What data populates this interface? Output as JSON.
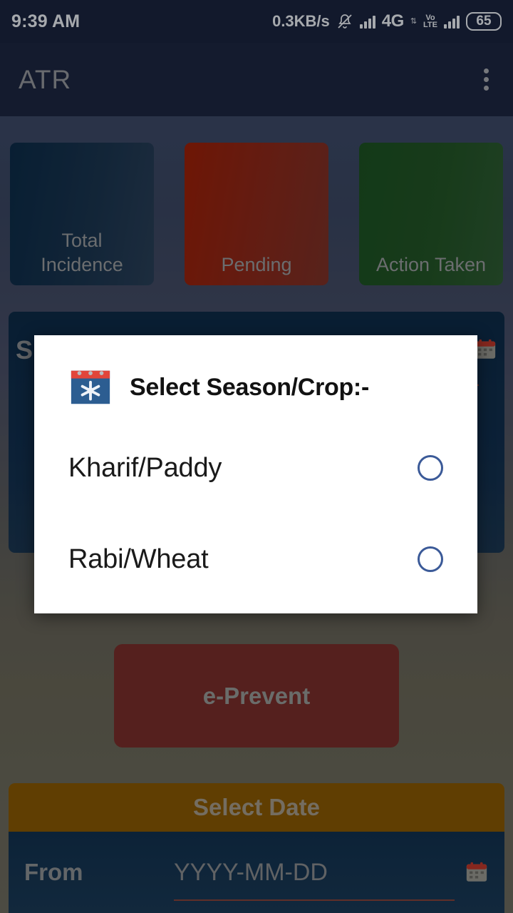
{
  "status_bar": {
    "time": "9:39 AM",
    "network_speed": "0.3KB/s",
    "mute_icon": "bell-muted-icon",
    "signal_icon_1": "signal-bars-icon",
    "network_type": "4G",
    "data_arrows": "⇅",
    "volte_top": "Vo",
    "volte_bottom": "LTE",
    "signal_icon_2": "signal-bars-icon",
    "battery_level": "65"
  },
  "app_bar": {
    "title": "ATR",
    "overflow_icon": "more-vertical-icon"
  },
  "stats": [
    {
      "label": "Total\nIncidence",
      "label_line1": "Total",
      "label_line2": "Incidence",
      "color": "#0c2c49",
      "name": "total-incidence"
    },
    {
      "label": "Pending",
      "label_line1": "Pending",
      "label_line2": "",
      "color": "#9e2008",
      "name": "pending"
    },
    {
      "label": "Action Taken",
      "label_line1": "Action Taken",
      "label_line2": "",
      "color": "#1c5223",
      "name": "action-taken"
    }
  ],
  "season_card": {
    "label": "S",
    "calendar_icon": "calendar-icon"
  },
  "eprevent": {
    "label": "e-Prevent",
    "color": "#7a2f2b"
  },
  "date_panel": {
    "header": "Select Date",
    "header_color": "#8a5a04",
    "from_label": "From",
    "from_placeholder": "YYYY-MM-DD",
    "calendar_icon": "calendar-icon"
  },
  "dialog": {
    "icon": "calendar-snowflake-icon",
    "title": "Select Season/Crop:-",
    "accent_color": "#3b5a98",
    "options": [
      {
        "label": "Kharif/Paddy",
        "selected": false
      },
      {
        "label": "Rabi/Wheat",
        "selected": false
      }
    ]
  }
}
